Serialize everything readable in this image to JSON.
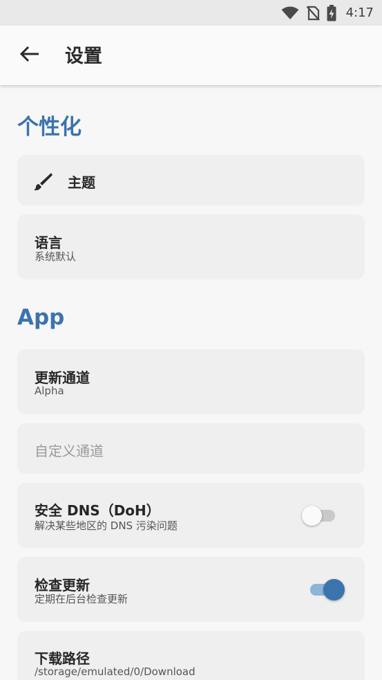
{
  "status_bar": {
    "time": "4:17",
    "icons": [
      "wifi-icon",
      "no-sim-icon",
      "battery-charging-icon"
    ]
  },
  "app_bar": {
    "back_icon": "arrow-left-icon",
    "title": "设置"
  },
  "sections": {
    "personalization": {
      "title": "个性化",
      "theme": {
        "icon": "brush-icon",
        "label": "主题"
      },
      "language": {
        "label": "语言",
        "value": "系统默认"
      }
    },
    "app": {
      "title": "App",
      "update_channel": {
        "label": "更新通道",
        "value": "Alpha"
      },
      "custom_channel": {
        "label": "自定义通道"
      },
      "secure_dns": {
        "label": "安全 DNS（DoH）",
        "description": "解决某些地区的 DNS 污染问题",
        "enabled": false
      },
      "check_updates": {
        "label": "检查更新",
        "description": "定期在后台检查更新",
        "enabled": true
      },
      "download_path": {
        "label": "下载路径",
        "value": "/storage/emulated/0/Download"
      }
    }
  },
  "colors": {
    "accent": "#3b73ad",
    "switch_on_track": "#8fb4d9",
    "switch_on_thumb": "#3b73ad",
    "switch_off_track": "#c9c9c9",
    "switch_off_thumb": "#fafafa"
  }
}
